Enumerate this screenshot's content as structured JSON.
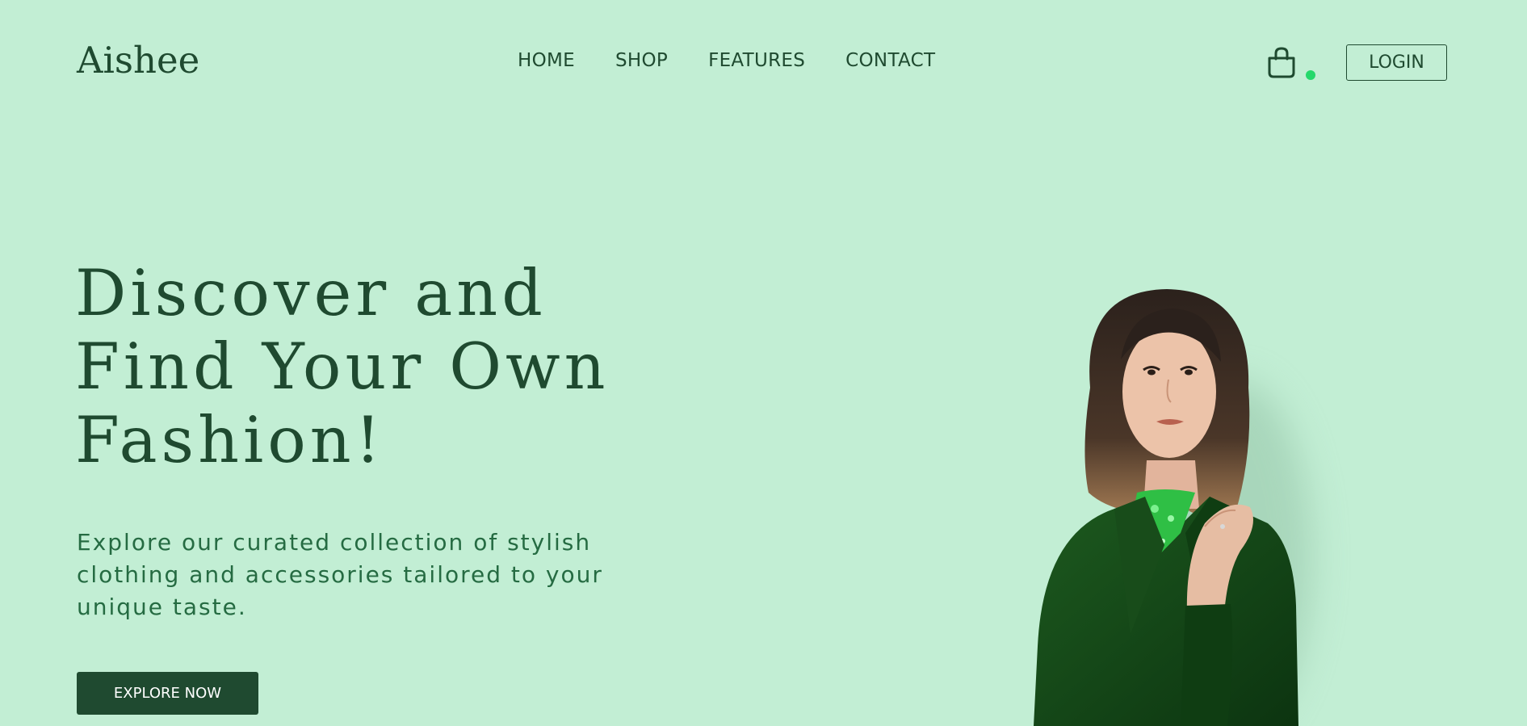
{
  "header": {
    "logo": "Aishee",
    "nav": [
      "HOME",
      "SHOP",
      "FEATURES",
      "CONTACT"
    ],
    "cart_icon": "shopping-bag-icon",
    "login_label": "LOGIN"
  },
  "hero": {
    "title_lines": [
      "Discover and",
      "Find Your Own",
      "Fashion!"
    ],
    "subtitle": "Explore our curated collection of stylish clothing and accessories tailored to your unique taste.",
    "cta_label": "EXPLORE NOW",
    "image": "fashion-model-photo"
  },
  "colors": {
    "background": "#c2eed4",
    "primary": "#1f4a30",
    "subtitle": "#256b42",
    "cart_badge": "#25d86b"
  }
}
